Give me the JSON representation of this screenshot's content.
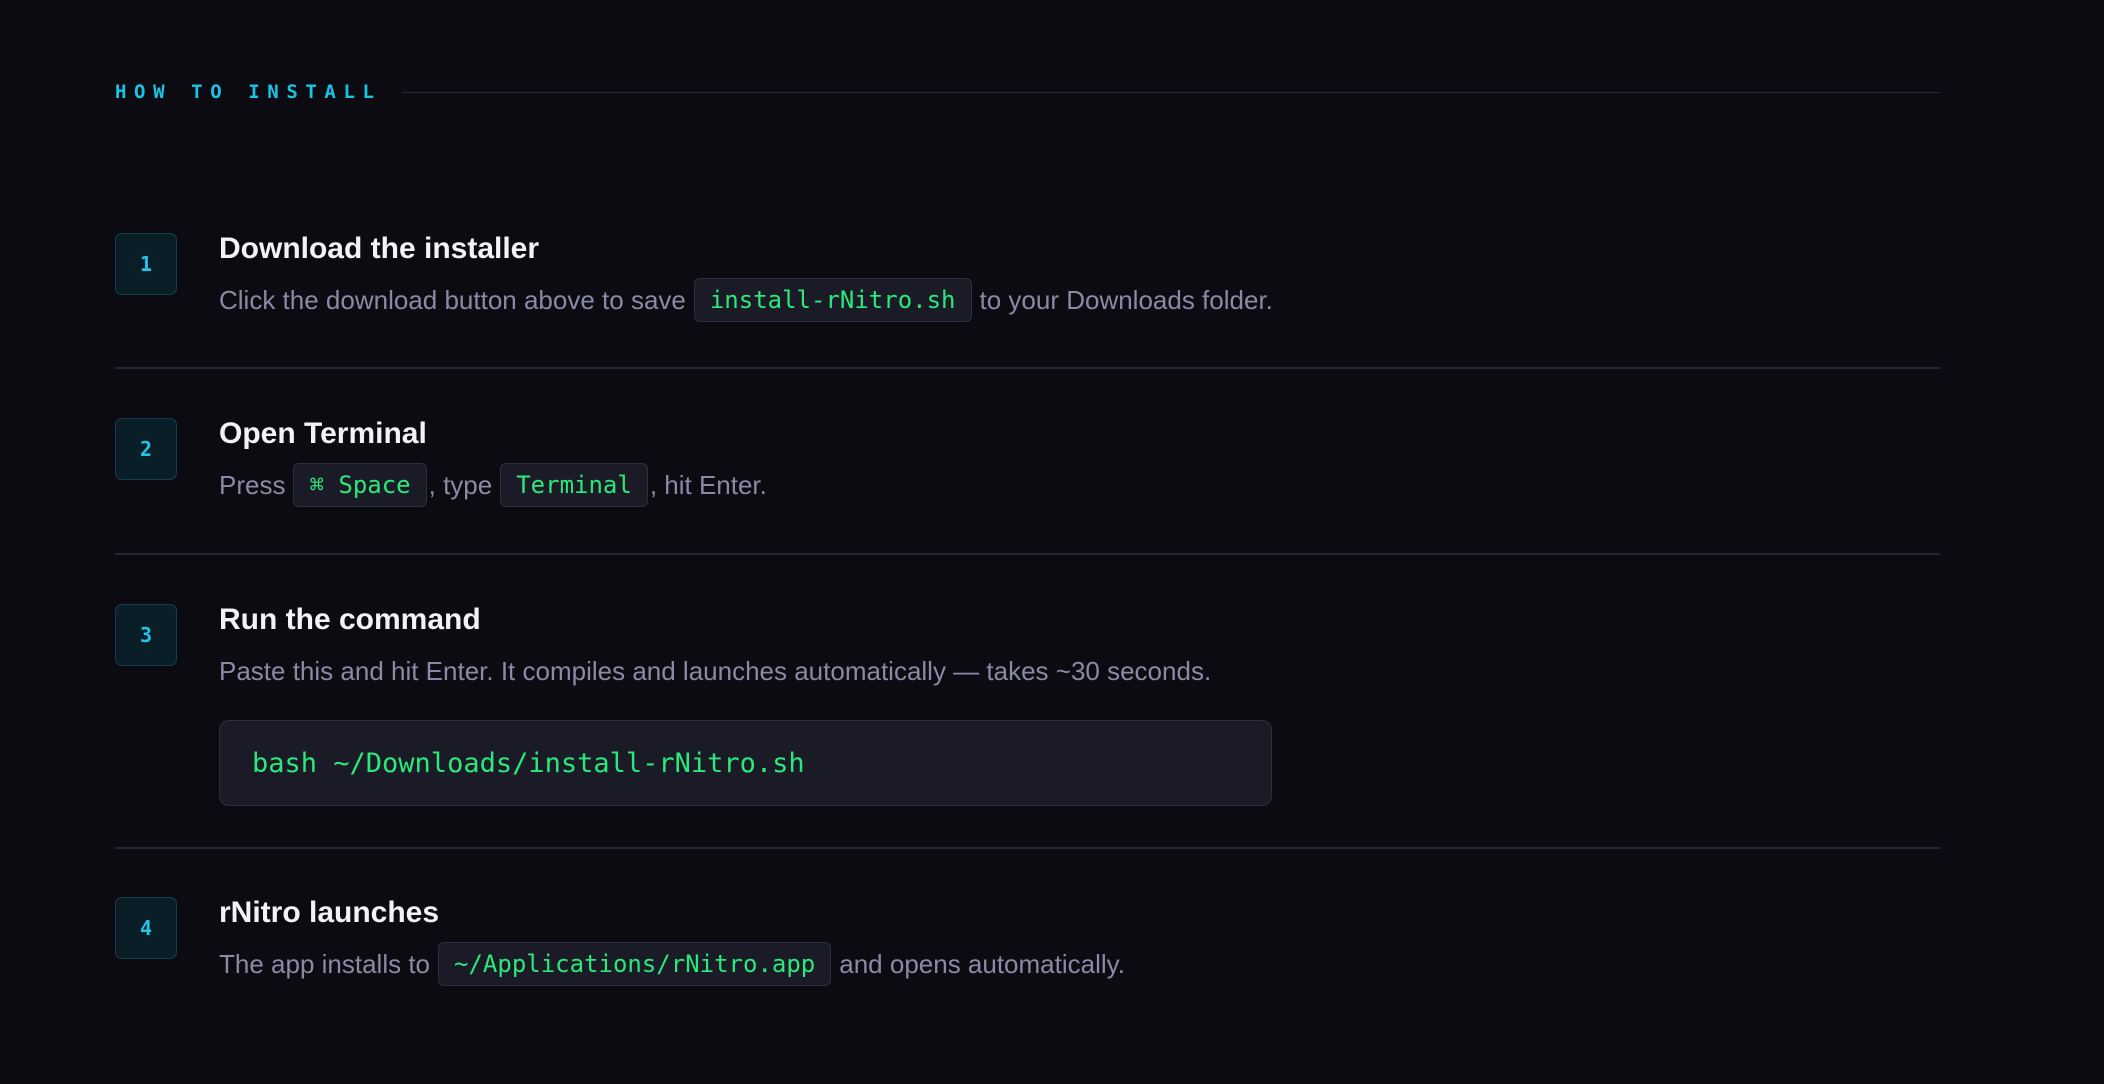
{
  "section": {
    "title": "HOW TO INSTALL"
  },
  "steps": [
    {
      "number": "1",
      "title": "Download the installer",
      "desc_before": "Click the download button above to save",
      "code1": "install-rNitro.sh",
      "desc_after": "to your Downloads folder."
    },
    {
      "number": "2",
      "title": "Open Terminal",
      "desc_before": "Press",
      "code1": "⌘ Space",
      "desc_middle": ", type",
      "code2": "Terminal",
      "desc_after": ", hit Enter."
    },
    {
      "number": "3",
      "title": "Run the command",
      "desc": "Paste this and hit Enter. It compiles and launches automatically — takes ~30 seconds.",
      "command": "bash ~/Downloads/install-rNitro.sh"
    },
    {
      "number": "4",
      "title": "rNitro launches",
      "desc_before": "The app installs to",
      "code1": "~/Applications/rNitro.app",
      "desc_after": "and opens automatically."
    }
  ],
  "colors": {
    "background": "#0b0b11",
    "accent": "#19c3e6",
    "code_text": "#2ae87a",
    "muted_text": "#8a8aa6",
    "title_text": "#f2f2f8"
  }
}
